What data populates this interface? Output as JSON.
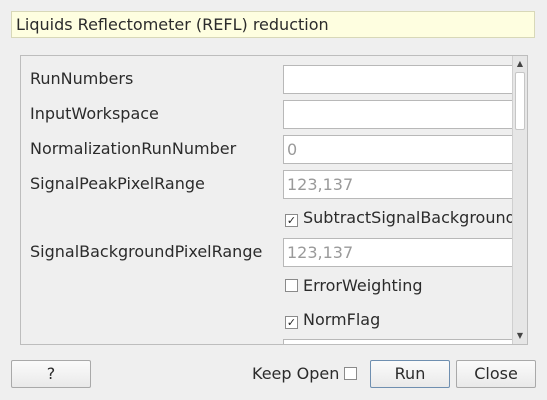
{
  "window": {
    "title": "Liquids Reflectometer (REFL) reduction"
  },
  "properties": [
    {
      "label": "RunNumbers",
      "value": ""
    },
    {
      "label": "InputWorkspace",
      "value": ""
    },
    {
      "label": "NormalizationRunNumber",
      "value": "0"
    },
    {
      "label": "SignalPeakPixelRange",
      "value": "123,137"
    },
    {
      "label": "SignalBackgroundPixelRange",
      "value": "123,137"
    }
  ],
  "checkboxes": [
    {
      "label": "SubtractSignalBackground",
      "checked": true
    },
    {
      "label": "ErrorWeighting",
      "checked": false
    },
    {
      "label": "NormFlag",
      "checked": true
    }
  ],
  "scrollbar": {
    "up_arrow": "▲",
    "down_arrow": "▼"
  },
  "buttons": {
    "help": "?",
    "keep_open": "Keep Open",
    "keep_open_checked": false,
    "run": "Run",
    "close": "Close"
  },
  "icons": {
    "check_mark": "✓"
  }
}
